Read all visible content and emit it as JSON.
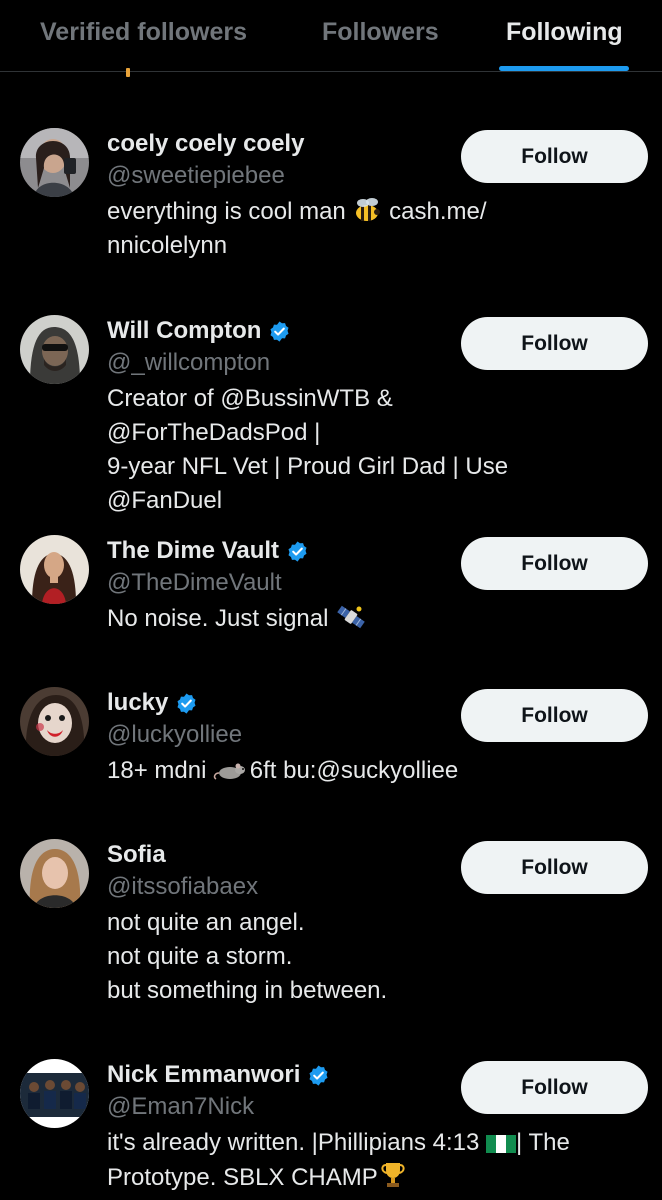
{
  "tabs": [
    {
      "label": "Verified followers",
      "active": false
    },
    {
      "label": "Followers",
      "active": false
    },
    {
      "label": "Following",
      "active": true
    }
  ],
  "colors": {
    "background": "#000000",
    "accent": "#1d9bf0",
    "primary_text": "#e7e9ea",
    "secondary_text": "#71767b",
    "button_bg": "#eff3f4",
    "button_text": "#0f1419"
  },
  "users": [
    {
      "display_name": "coely coely coely",
      "handle": "@sweetiepiebee",
      "verified": false,
      "bio_1": "everything is cool man",
      "bio_emoji_1": "bee-emoji",
      "bio_2": "cash.me/",
      "bio_3": "nnicolelynn",
      "follow_label": "Follow"
    },
    {
      "display_name": "Will Compton",
      "handle": "@_willcompton",
      "verified": true,
      "bio": "Creator of @BussinWTB & @ForTheDadsPod |\n9-year NFL Vet | Proud Girl Dad | Use\n@FanDuel",
      "follow_label": "Follow"
    },
    {
      "display_name": "The Dime Vault",
      "handle": "@TheDimeVault",
      "verified": true,
      "bio": "No noise. Just signal",
      "bio_emoji": "satellite-emoji",
      "follow_label": "Follow"
    },
    {
      "display_name": "lucky",
      "handle": "@luckyolliee",
      "verified": true,
      "bio_1": "18+ mdni",
      "bio_emoji": "rat-emoji",
      "bio_2": "6ft bu:@suckyolliee",
      "follow_label": "Follow"
    },
    {
      "display_name": "Sofia",
      "handle": "@itssofiabaex",
      "verified": false,
      "bio": "not quite an angel.\nnot quite a storm.\nbut something in between.",
      "follow_label": "Follow"
    },
    {
      "display_name": "Nick Emmanwori",
      "handle": "@Eman7Nick",
      "verified": true,
      "bio_1": "it's already written. |Phillipians 4:13",
      "bio_emoji_1": "nigeria-flag-emoji",
      "bio_2": "| The",
      "bio_3": "Prototype. SBLX CHAMP",
      "bio_emoji_2": "trophy-emoji",
      "follow_label": "Follow"
    }
  ]
}
